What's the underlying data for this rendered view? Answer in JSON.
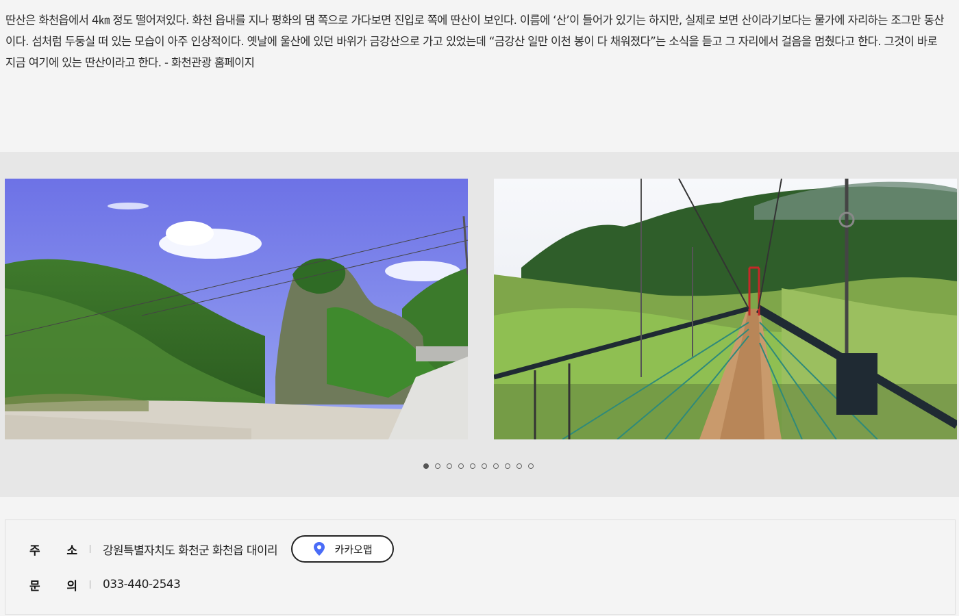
{
  "description": "딴산은 화천읍에서 4㎞ 정도 떨어져있다. 화천 읍내를 지나 평화의 댐 쪽으로 가다보면 진입로 쪽에 딴산이 보인다. 이름에 ‘산’이 들어가 있기는 하지만, 실제로 보면 산이라기보다는 물가에 자리하는 조그만 동산이다. 섬처럼 두둥실 떠 있는 모습이 아주 인상적이다. 옛날에 울산에 있던 바위가 금강산으로 가고 있었는데 “금강산 일만 이천 봉이 다 채워졌다”는 소식을 듣고 그 자리에서 걸음을 멈췄다고 한다. 그것이 바로 지금 여기에 있는 딴산이라고 한다. - 화천관광 홈페이지",
  "gallery": {
    "slides": [
      "rock-mountain-photo",
      "suspension-bridge-photo"
    ],
    "dot_count": 10,
    "active_dot": 1
  },
  "info": {
    "address_label": "주 소",
    "address_label_chars": [
      "주",
      "소"
    ],
    "address": "강원특별자치도 화천군 화천읍 대이리",
    "map_button": "카카오맵",
    "map_icon": "map-pin-icon",
    "phone_label_chars": [
      "문",
      "의"
    ],
    "phone": "033-440-2543"
  },
  "colors": {
    "pin": "#4a6cf7",
    "gallery_bg": "#e7e7e7",
    "page_bg": "#f4f4f4"
  }
}
